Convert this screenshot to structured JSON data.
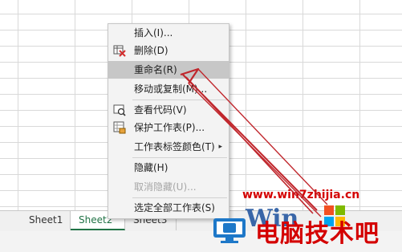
{
  "context_menu": {
    "items": [
      {
        "label": "插入(I)...",
        "icon": "insert"
      },
      {
        "label": "删除(D)",
        "icon": "delete-sheet-icon"
      },
      {
        "label": "重命名(R)",
        "icon": "",
        "highlighted": true
      },
      {
        "label": "移动或复制(M)...",
        "icon": ""
      },
      {
        "label": "查看代码(V)",
        "icon": "view-code-icon"
      },
      {
        "label": "保护工作表(P)...",
        "icon": "protect-sheet-icon"
      },
      {
        "label": "工作表标签颜色(T)",
        "icon": "",
        "submenu": true
      },
      {
        "label": "隐藏(H)",
        "icon": ""
      },
      {
        "label": "取消隐藏(U)...",
        "icon": "",
        "disabled": true
      },
      {
        "label": "选定全部工作表(S)",
        "icon": ""
      }
    ],
    "submenu_arrow": "▸"
  },
  "sheet_tabs": [
    {
      "label": "Sheet1",
      "active": false
    },
    {
      "label": "Sheet2",
      "active": true
    },
    {
      "label": "Sheet3",
      "active": false
    }
  ],
  "watermark": {
    "url": "www.win7zhijia.cn",
    "text": "电脑技术吧"
  },
  "colors": {
    "annotation_arrow": "#c0262c",
    "active_tab": "#217346",
    "watermark": "#d40000"
  }
}
